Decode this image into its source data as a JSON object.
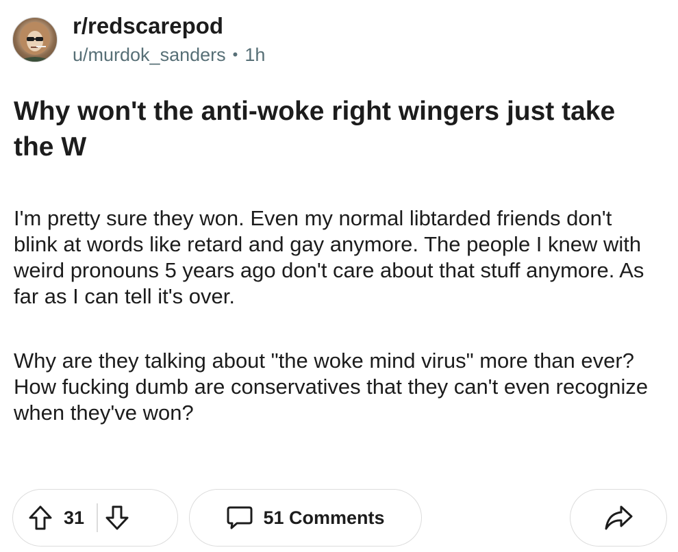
{
  "post": {
    "subreddit": "r/redscarepod",
    "username": "u/murdok_sanders",
    "separator": "•",
    "age": "1h",
    "title": "Why won't the anti-woke right wingers just take the W",
    "body": [
      "I'm pretty sure they won. Even my normal libtarded friends don't blink at words like retard and gay anymore. The people I knew with weird pronouns 5 years ago don't care about that stuff anymore. As far as I can tell it's over.",
      "Why are they talking about \"the woke mind virus\" more than ever? How fucking dumb are conservatives that they can't even recognize when they've won?"
    ]
  },
  "actions": {
    "vote_count": "31",
    "comments_label": "51 Comments"
  },
  "icons": {
    "avatar": "subreddit-avatar",
    "upvote": "upvote-arrow-icon",
    "downvote": "downvote-arrow-icon",
    "comments": "speech-bubble-icon",
    "share": "share-arrow-icon"
  },
  "colors": {
    "text": "#1c1c1c",
    "meta": "#576f76",
    "border": "#dcdcdc"
  }
}
